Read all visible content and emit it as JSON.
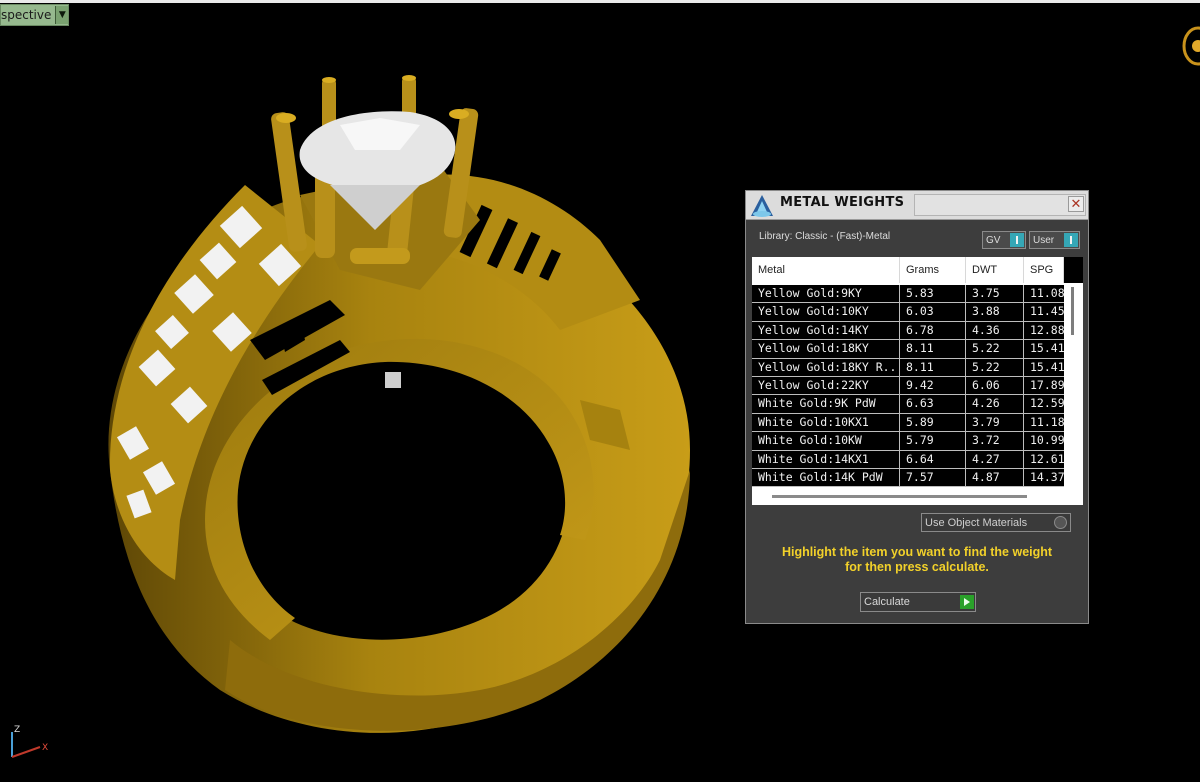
{
  "viewport": {
    "label": "spective",
    "axis_z": "Z",
    "axis_x": "X"
  },
  "panel": {
    "title": "METAL WEIGHTS",
    "close": "✕",
    "library_label": "Library: Classic - (Fast)-Metal",
    "gv_label": "GV",
    "user_label": "User",
    "columns": [
      "Metal",
      "Grams",
      "DWT",
      "SPG"
    ],
    "rows": [
      {
        "metal": "Yellow Gold:9KY",
        "grams": "5.83",
        "dwt": "3.75",
        "spg": "11.08"
      },
      {
        "metal": "Yellow Gold:10KY",
        "grams": "6.03",
        "dwt": "3.88",
        "spg": "11.45"
      },
      {
        "metal": "Yellow Gold:14KY",
        "grams": "6.78",
        "dwt": "4.36",
        "spg": "12.88"
      },
      {
        "metal": "Yellow Gold:18KY",
        "grams": "8.11",
        "dwt": "5.22",
        "spg": "15.41"
      },
      {
        "metal": "Yellow Gold:18KY R...",
        "grams": "8.11",
        "dwt": "5.22",
        "spg": "15.41"
      },
      {
        "metal": "Yellow Gold:22KY",
        "grams": "9.42",
        "dwt": "6.06",
        "spg": "17.89"
      },
      {
        "metal": "White Gold:9K PdW",
        "grams": "6.63",
        "dwt": "4.26",
        "spg": "12.59"
      },
      {
        "metal": "White Gold:10KX1",
        "grams": "5.89",
        "dwt": "3.79",
        "spg": "11.18"
      },
      {
        "metal": "White Gold:10KW",
        "grams": "5.79",
        "dwt": "3.72",
        "spg": "10.99"
      },
      {
        "metal": "White Gold:14KX1",
        "grams": "6.64",
        "dwt": "4.27",
        "spg": "12.61"
      },
      {
        "metal": "White Gold:14K PdW",
        "grams": "7.57",
        "dwt": "4.87",
        "spg": "14.37"
      }
    ],
    "use_object_materials": "Use Object Materials",
    "hint_line1": "Highlight the item you want to find the weight",
    "hint_line2": "for then press calculate.",
    "calculate_label": "Calculate"
  },
  "colors": {
    "gold": "#b08a12",
    "gold_dark": "#7a5d08",
    "gold_light": "#d2a81e",
    "viewport_label_bg": "#96b98e",
    "hint_text": "#f2d12a",
    "accent_button": "#35a7b6",
    "calculate_button": "#2aa12a"
  }
}
